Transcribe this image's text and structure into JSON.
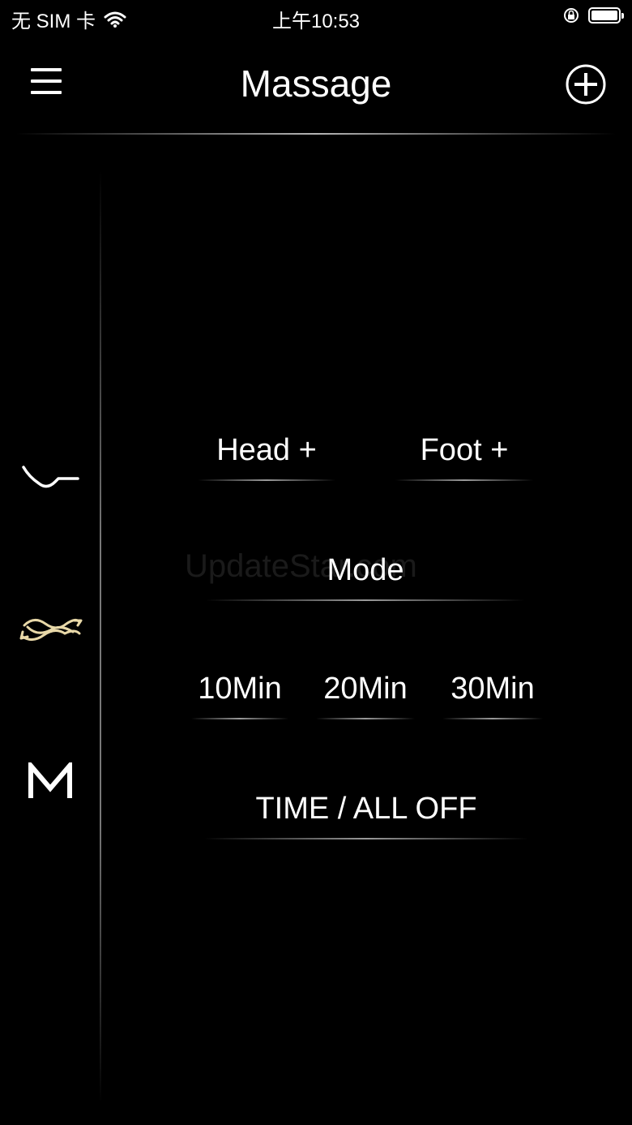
{
  "status_bar": {
    "carrier": "无 SIM 卡",
    "time": "上午10:53",
    "icons": [
      "wifi-icon",
      "orientation-lock-icon",
      "battery-icon"
    ]
  },
  "nav": {
    "title": "Massage",
    "menu_icon": "hamburger-menu-icon",
    "add_icon": "plus-circle-icon"
  },
  "sidebar": {
    "items": [
      {
        "icon": "bed-position-icon"
      },
      {
        "icon": "wave-massage-icon",
        "active": true
      },
      {
        "icon": "memory-m-icon",
        "label": "M"
      }
    ]
  },
  "controls": {
    "head_plus": "Head +",
    "foot_plus": "Foot +",
    "mode": "Mode",
    "timers": [
      "10Min",
      "20Min",
      "30Min"
    ],
    "time_all_off": "TIME / ALL OFF"
  },
  "watermark": "UpdateStar.com",
  "colors": {
    "background": "#000000",
    "text": "#ffffff",
    "accent_gold": "#e8d8a8"
  }
}
